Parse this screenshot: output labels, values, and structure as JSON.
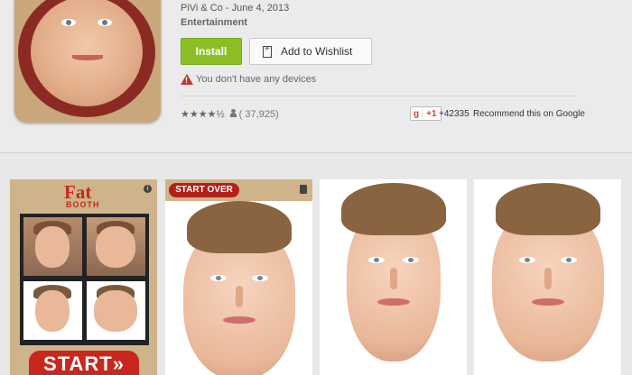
{
  "app": {
    "developer": "PiVi & Co",
    "date": " - June 4, 2013",
    "category": "Entertainment"
  },
  "actions": {
    "install_label": "Install",
    "wishlist_label": "Add to Wishlist"
  },
  "warning": {
    "text": "You don't have any devices",
    "icon_glyph": "!"
  },
  "rating": {
    "stars": "★★★★½",
    "count": "( 37,925)",
    "star_value": 4.5
  },
  "social": {
    "gplus_logo": "g",
    "gplus_label": "+1",
    "gplus_count": "+42335",
    "recommend_text": "Recommend this on Google"
  },
  "screenshots": {
    "logo_line1": "Fat",
    "logo_line2": "BOOTH",
    "info_glyph": "i",
    "start_label": "START»",
    "start_over_label": "START OVER"
  },
  "colors": {
    "install": "#8cbf26",
    "brand_red": "#c8261e"
  }
}
